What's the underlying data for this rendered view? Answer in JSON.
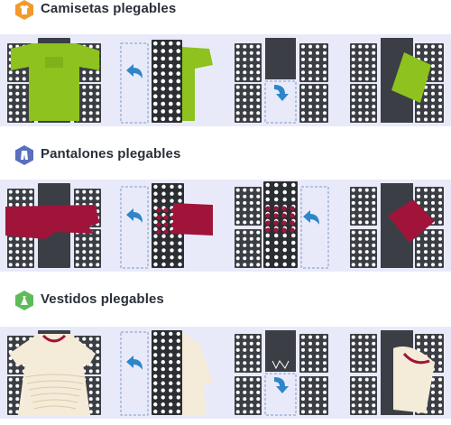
{
  "sections": [
    {
      "title": "Camisetas plegables",
      "icon": "shirt-icon",
      "icon_color": "#f39a2c",
      "garment_color": "#8dc21f"
    },
    {
      "title": "Pantalones plegables",
      "icon": "pants-icon",
      "icon_color": "#5a6fbe",
      "garment_color": "#a0143a"
    },
    {
      "title": "Vestidos plegables",
      "icon": "dress-icon",
      "icon_color": "#5dbb5a",
      "garment_color": "#f4ebd8"
    }
  ],
  "colors": {
    "background_band": "#e9eaf9",
    "board": "#3b3f45",
    "board_dark": "#2b2e33",
    "hole": "#ffffff",
    "arrow": "#2e86c9",
    "dashed_outline": "#7a9cc6"
  }
}
